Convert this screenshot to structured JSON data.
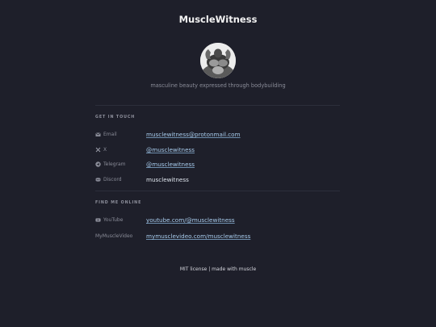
{
  "header": {
    "title": "MuscleWitness",
    "tagline": "masculine beauty expressed through bodybuilding"
  },
  "avatar": {
    "alt": "profile photo"
  },
  "sections": {
    "contact": {
      "heading": "GET IN TOUCH",
      "rows": [
        {
          "icon": "mail-icon",
          "label": "Email",
          "value": "musclewitness@protonmail.com",
          "link": true
        },
        {
          "icon": "x-logo-icon",
          "label": "X",
          "value": "@musclewitness",
          "link": true
        },
        {
          "icon": "telegram-icon",
          "label": "Telegram",
          "value": "@musclewitness",
          "link": true
        },
        {
          "icon": "discord-icon",
          "label": "Discord",
          "value": "musclewitness",
          "link": false
        }
      ]
    },
    "online": {
      "heading": "FIND ME ONLINE",
      "rows": [
        {
          "icon": "youtube-icon",
          "label": "YouTube",
          "value": "youtube.com/@musclewitness",
          "link": true
        },
        {
          "icon": "",
          "label": "MyMuscleVideo",
          "value": "mymusclevideo.com/musclewitness",
          "link": true
        }
      ]
    }
  },
  "footer": {
    "text": "MIT license | made with muscle"
  },
  "colors": {
    "background": "#1e1f2a",
    "link": "#a9cdee",
    "muted": "#8a8c98"
  }
}
